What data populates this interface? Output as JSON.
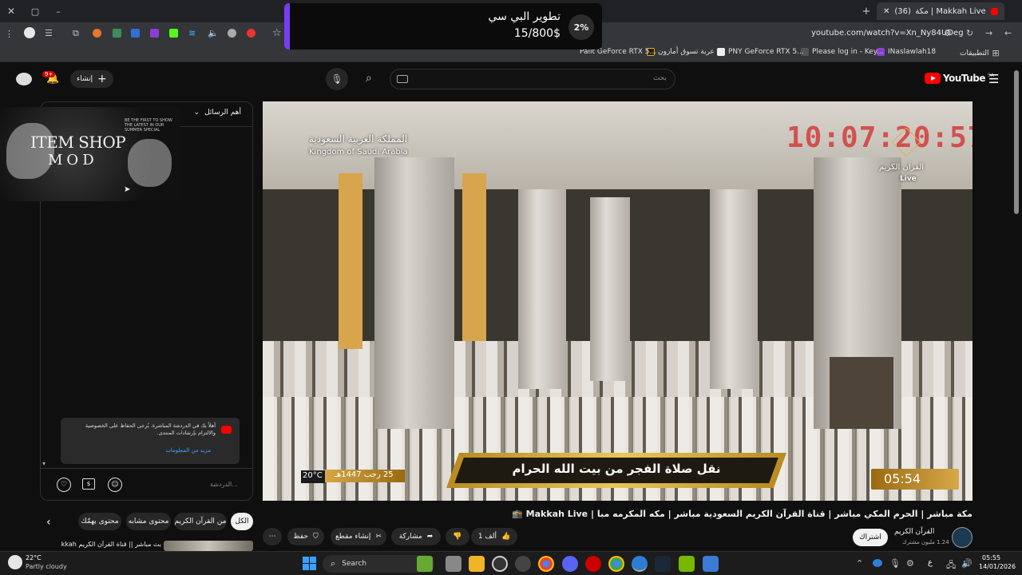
{
  "browser": {
    "tab_title": "Makkah Live | مكة مبا...",
    "tab_badge": "(36)",
    "url": "youtube.com/watch?v=Xn_Ny84UDeg",
    "bookmarks": [
      "التطبيقات",
      "INaslawlah18",
      "Please log in - Key...",
      "PNY GeForce RTX 5...",
      "عربة تسوق أمازون",
      "Palit GeForce RTX 5..."
    ]
  },
  "donation": {
    "title": "تطوير البي سي",
    "amount": "15/800$",
    "percent": "2%",
    "progress": 0.02
  },
  "youtube": {
    "brand": "YouTube",
    "region": "SA",
    "search_placeholder": "بحث",
    "create_label": "إنشاء",
    "notification_count": "9+"
  },
  "chat": {
    "header": "أهم الرسائل",
    "placeholder": "الدردشة...",
    "notice_text": "أهلاً بك في الدردشة المباشرة. يُرجى الحفاظ على الخصوصية والالتزام بإرشادات المنتدى.",
    "notice_link": "مزيد من المعلومات",
    "ad_title_1": "ITEM SHOP",
    "ad_title_2": "MOD",
    "ad_caption": "BE THE FIRST TO SHOW THE LATEST IN OUR SUMMER SPECIAL"
  },
  "video": {
    "channel_ar": "المملكة العربية السعودية",
    "channel_en": "Kingdom of Saudi Arabia",
    "clock": "10:07:20:57",
    "quran_logo": "القرآن الكريم",
    "live_label": "Live",
    "banner": "نقل صلاة الفجر من بيت الله الحرام",
    "time": "05:54",
    "date": "25 رجب 1447هـ",
    "temperature": "20°C"
  },
  "info": {
    "title": "مكة مباشر | الحرم المكي مباشر | قناة القرآن الكريم السعودية مباشر | مكه المكرمه مبا | Makkah Live 🕋",
    "channel": "القرآن الكريم",
    "subscribers": "1.24 مليون مشترك",
    "subscribe": "اشتراك",
    "likes": "1 ألف",
    "share": "مشاركة",
    "clip": "إنشاء مقطع",
    "save": "حفظ"
  },
  "chips": [
    "الكل",
    "من القرآن الكريم",
    "محتوى مشابه",
    "محتوى يهمّك"
  ],
  "recommendation": "بث مباشر || قناة القرآن الكريم Makkah",
  "taskbar": {
    "weather_temp": "22°C",
    "weather_desc": "Partly cloudy",
    "search": "Search",
    "time": "05:55",
    "date": "14/01/2026",
    "lang": "ع"
  },
  "colors": {
    "accent_purple": "#7a3cf2",
    "youtube_red": "#ff0000",
    "banner_gold": "#c9a227",
    "clock_red": "#d42020"
  }
}
